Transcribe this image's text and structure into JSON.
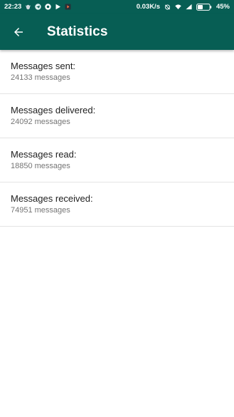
{
  "status_bar": {
    "time": "22:23",
    "network_speed": "0.03K/s",
    "battery_percent": "45%",
    "battery_level": 0.45,
    "notification_icons": [
      "bug-icon",
      "telegram-icon",
      "chrome-icon",
      "play-store-icon",
      "play-music-icon"
    ]
  },
  "app_bar": {
    "title": "Statistics",
    "back_icon": "arrow-back-icon"
  },
  "stats": [
    {
      "label": "Messages sent:",
      "value": "24133 messages"
    },
    {
      "label": "Messages delivered:",
      "value": "24092 messages"
    },
    {
      "label": "Messages read:",
      "value": "18850 messages"
    },
    {
      "label": "Messages received:",
      "value": "74951 messages"
    }
  ],
  "colors": {
    "primary": "#075e54",
    "divider": "#e4e4e4",
    "text_primary": "#212121",
    "text_secondary": "#757575"
  }
}
